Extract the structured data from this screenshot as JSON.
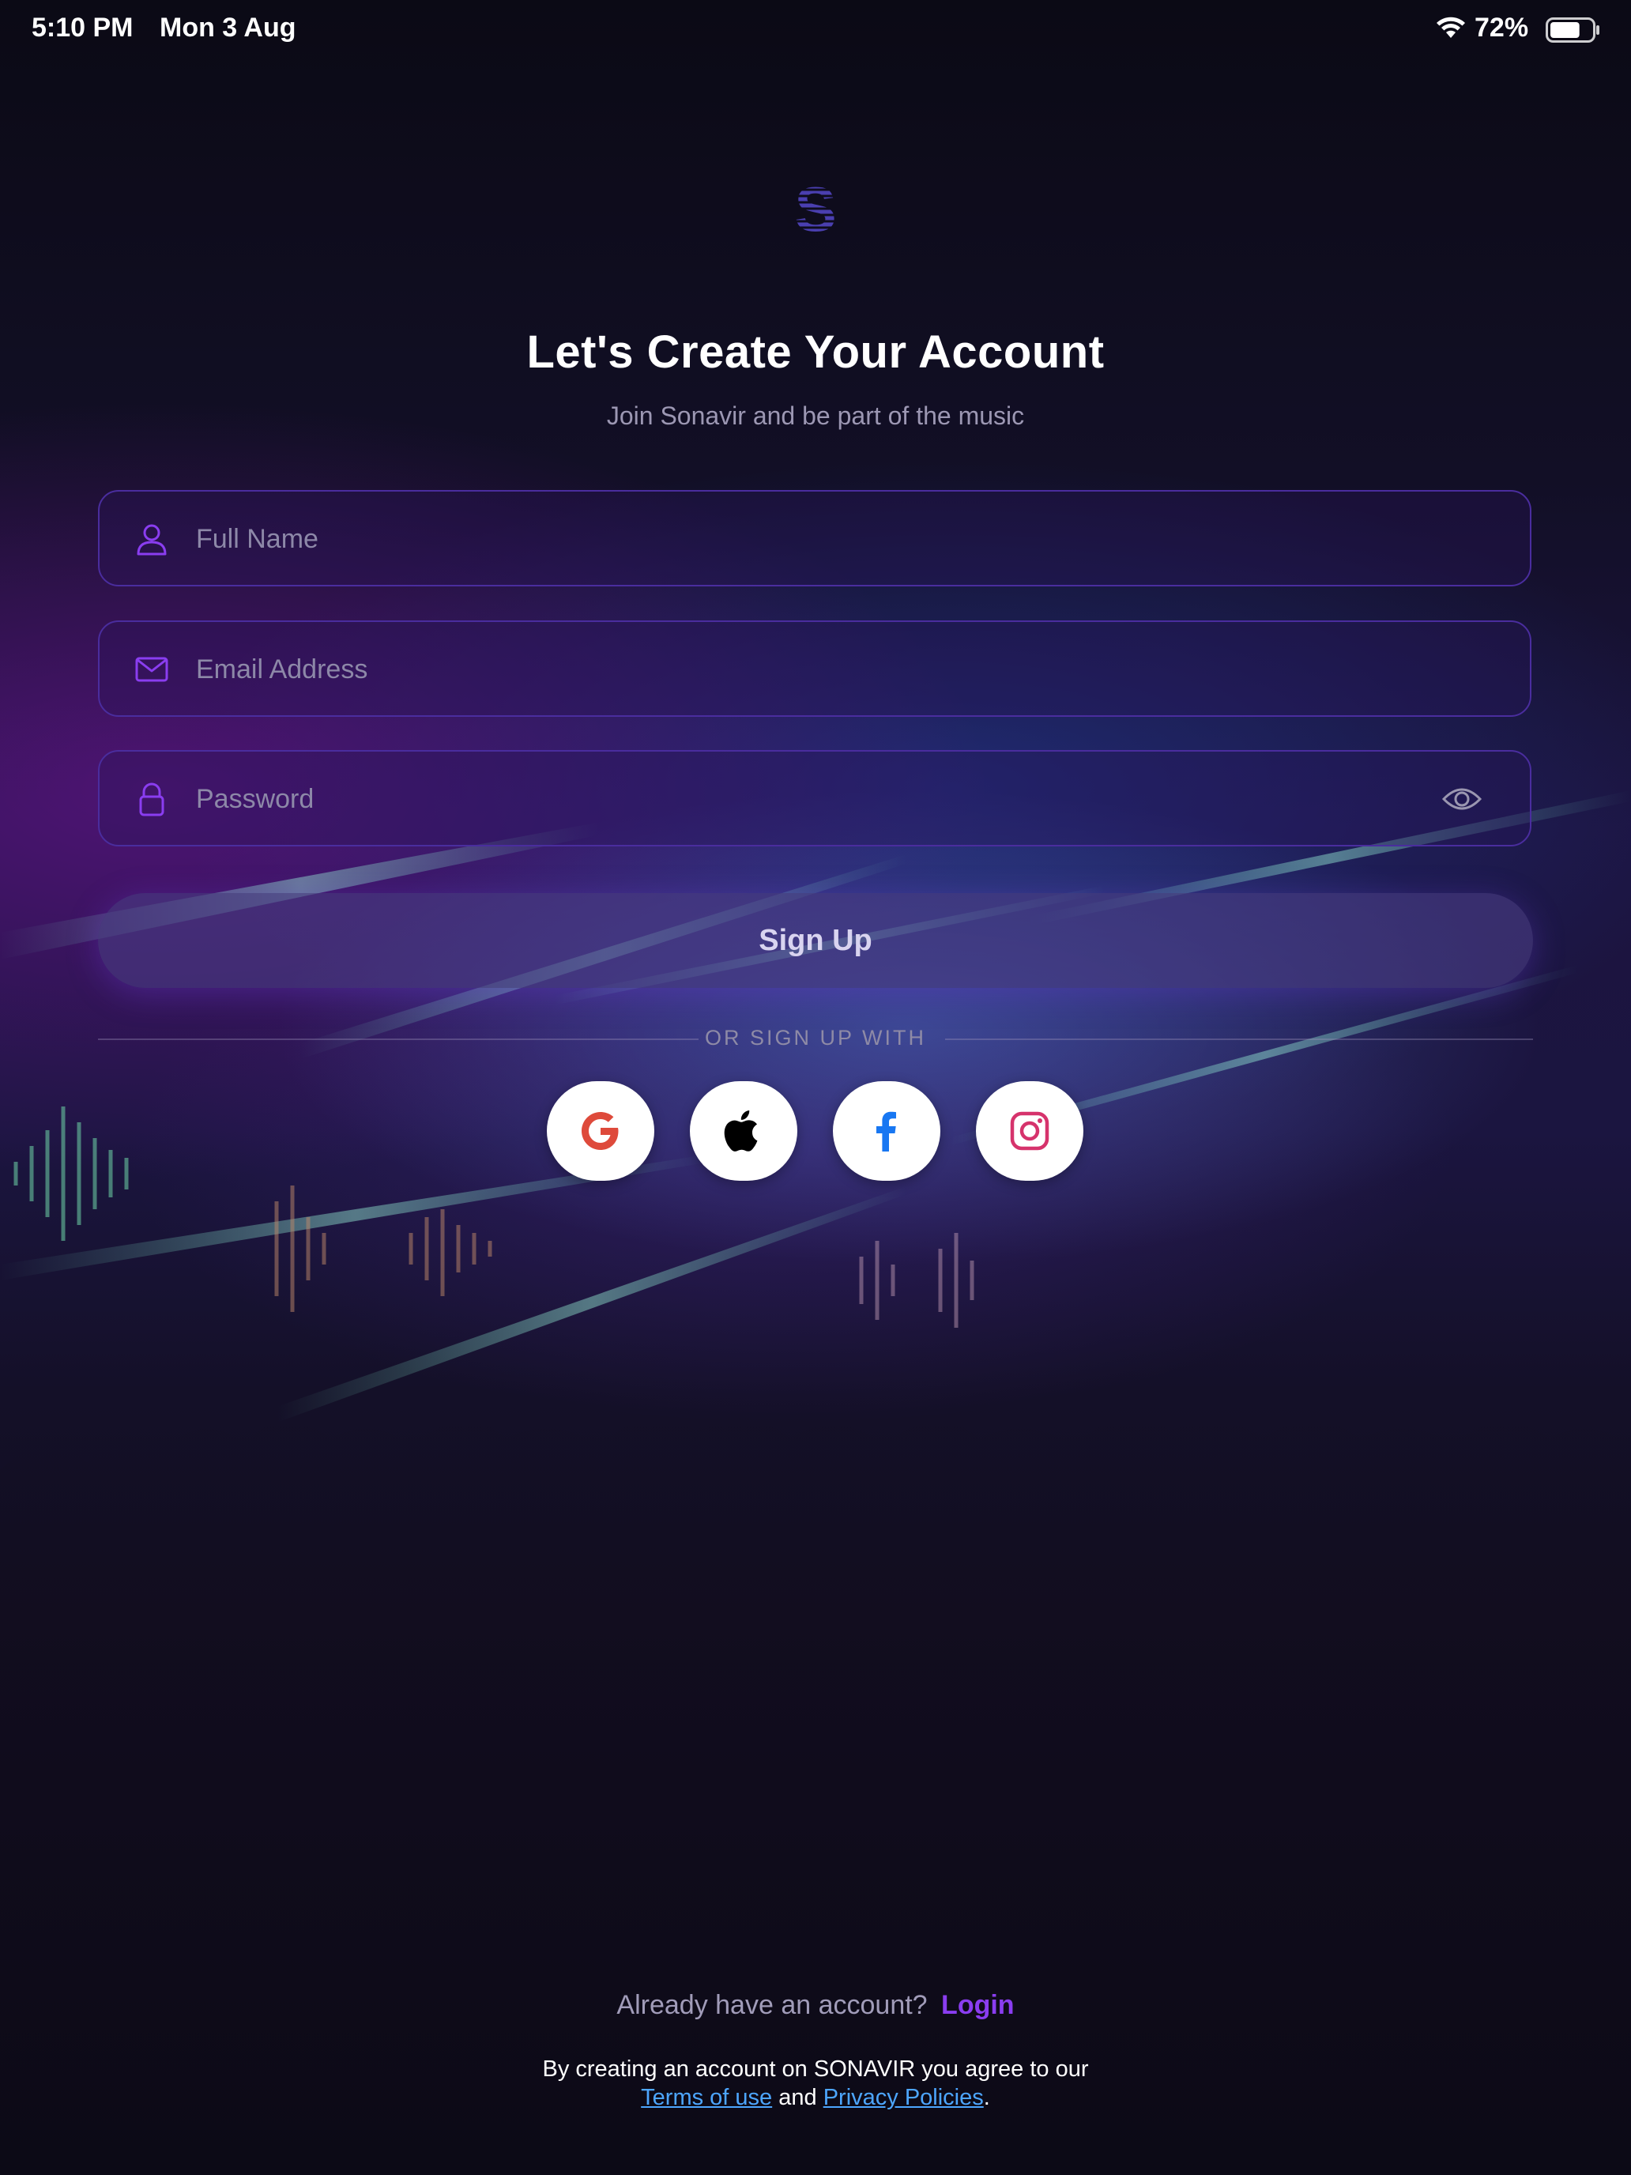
{
  "status_bar": {
    "time": "5:10 PM",
    "date": "Mon 3 Aug",
    "battery_percent": "72%",
    "battery_level": 0.72,
    "wifi_icon": "wifi-icon",
    "battery_icon": "battery-icon"
  },
  "branding": {
    "logo_icon": "sonavir-logo-icon",
    "accent_color": "#8a3df0",
    "background_image": "concert-crowd-photo"
  },
  "header": {
    "title": "Let's Create Your Account",
    "subtitle": "Join Sonavir and be part of the music"
  },
  "form": {
    "full_name": {
      "placeholder": "Full Name",
      "value": "",
      "icon": "user-icon"
    },
    "email": {
      "placeholder": "Email Address",
      "value": "",
      "icon": "mail-icon"
    },
    "password": {
      "placeholder": "Password",
      "value": "",
      "icon": "lock-icon",
      "toggle_icon": "eye-icon"
    },
    "submit_label": "Sign Up"
  },
  "social": {
    "divider_label": "OR SIGN UP WITH",
    "providers": [
      {
        "name": "google",
        "icon": "google-icon"
      },
      {
        "name": "apple",
        "icon": "apple-icon"
      },
      {
        "name": "facebook",
        "icon": "facebook-icon"
      },
      {
        "name": "instagram",
        "icon": "instagram-icon"
      }
    ]
  },
  "footer": {
    "have_account_text": "Already have an account?",
    "login_label": "Login",
    "terms_prefix": "By creating an account on SONAVIR you agree to our",
    "terms_link": "Terms of use",
    "and_text": "and",
    "privacy_link": "Privacy Policies",
    "period": "."
  }
}
